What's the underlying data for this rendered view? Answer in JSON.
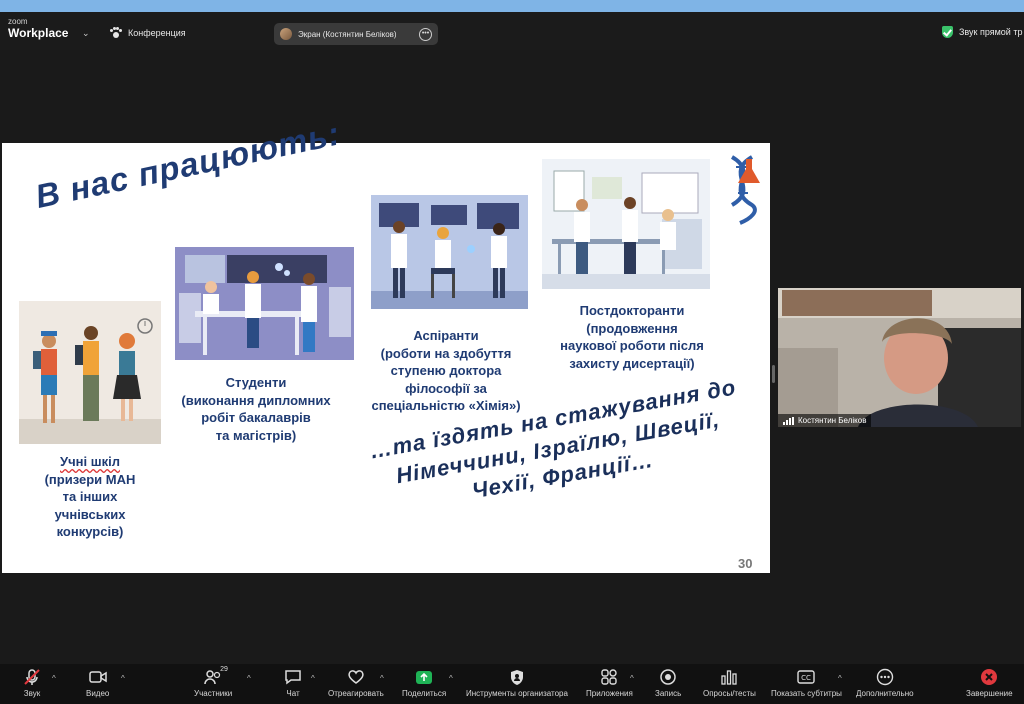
{
  "topbar": {
    "logo_line1": "zoom",
    "logo_line2": "Workplace",
    "meeting_label": "Конференция",
    "share_pill_label": "Экран (Костянтин Беліков)",
    "audio_status": "Звук прямой тр"
  },
  "slide": {
    "title": "В нас працюють:",
    "groups": [
      {
        "line1_underlined": "Учні шкіл",
        "rest": "(призери МАН\nта інших\nучнівських\nконкурсів)"
      },
      {
        "text": "Студенти\n(виконання дипломних\nробіт бакалаврів\nта магістрів)"
      },
      {
        "text": "Аспіранти\n(роботи на здобуття\nступеню доктора\nфілософії за\nспеціальністю «Хімія»)"
      },
      {
        "text": "Постдокторанти\n(продовження\nнаукової роботи після\nзахисту дисертації)"
      }
    ],
    "travel_text": "…та їздять на стажування до\nНімеччини, Ізраїлю, Швеції,\nЧехії, Франції…",
    "page_number": "30"
  },
  "video": {
    "participant_name": "Костянтин Беліков"
  },
  "toolbar": {
    "items": [
      {
        "label": "Звук",
        "icon": "mic-muted-icon"
      },
      {
        "label": "Видео",
        "icon": "video-camera-icon"
      },
      {
        "label": "Участники",
        "icon": "participants-icon",
        "count": "29"
      },
      {
        "label": "Чат",
        "icon": "chat-icon"
      },
      {
        "label": "Отреагировать",
        "icon": "heart-icon"
      },
      {
        "label": "Поделиться",
        "icon": "share-screen-icon"
      },
      {
        "label": "Инструменты организатора",
        "icon": "host-tools-shield-icon"
      },
      {
        "label": "Приложения",
        "icon": "apps-icon"
      },
      {
        "label": "Запись",
        "icon": "record-icon"
      },
      {
        "label": "Опросы/тесты",
        "icon": "polls-icon"
      },
      {
        "label": "Показать субтитры",
        "icon": "captions-icon"
      },
      {
        "label": "Дополнительно",
        "icon": "more-icon"
      },
      {
        "label": "Завершение",
        "icon": "end-meeting-icon"
      }
    ]
  },
  "colors": {
    "slide_text": "#1f3b73",
    "share_green": "#1fb356",
    "end_red": "#e0393e",
    "mute_red": "#e0393e"
  }
}
